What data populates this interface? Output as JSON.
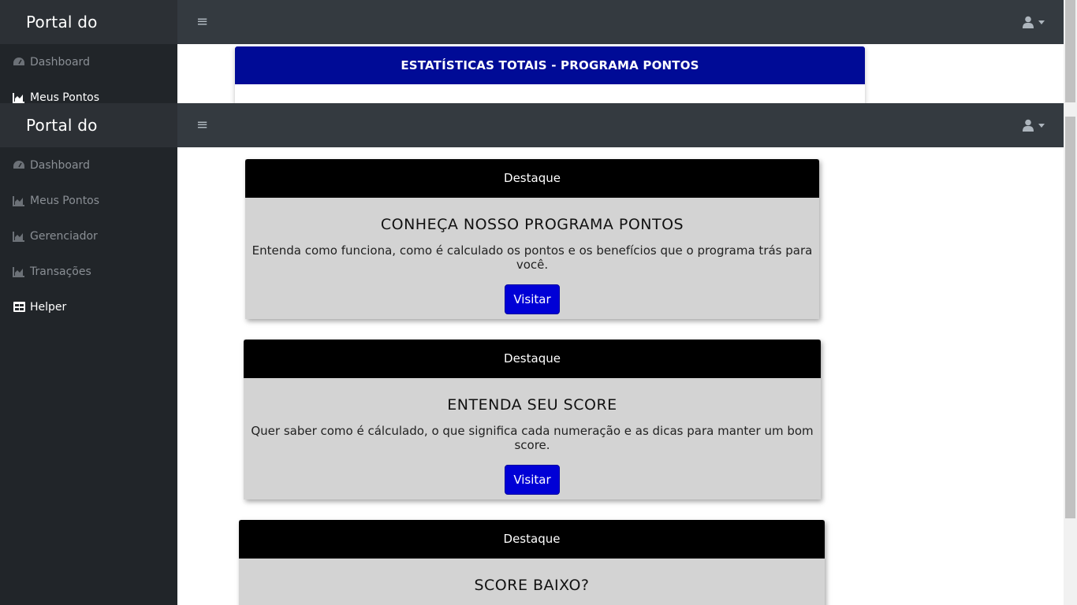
{
  "app": {
    "brand": "Portal do Consumidor",
    "menu_icon": "hamburger-icon",
    "user_icon": "user-icon"
  },
  "background_page": {
    "sidebar": [
      {
        "label": "Dashboard",
        "icon": "tachometer-icon",
        "active": false
      },
      {
        "label": "Meus Pontos",
        "icon": "area-chart-icon",
        "active": true
      }
    ],
    "stats_card_title": "ESTATÍSTICAS TOTAIS - PROGRAMA PONTOS"
  },
  "sidebar": {
    "items": [
      {
        "label": "Dashboard",
        "icon": "tachometer-icon",
        "active": false
      },
      {
        "label": "Meus Pontos",
        "icon": "area-chart-icon",
        "active": false
      },
      {
        "label": "Gerenciador",
        "icon": "area-chart-icon",
        "active": false
      },
      {
        "label": "Transações",
        "icon": "area-chart-icon",
        "active": false
      },
      {
        "label": "Helper",
        "icon": "table-icon",
        "active": true
      }
    ]
  },
  "cards": [
    {
      "header": "Destaque",
      "title": "CONHEÇA NOSSO PROGRAMA PONTOS",
      "text": "Entenda como funciona, como é calculado os pontos e os benefícios que o programa trás para você.",
      "button": "Visitar"
    },
    {
      "header": "Destaque",
      "title": "ENTENDA SEU SCORE",
      "text": "Quer saber como é cálculado, o que significa cada numeração e as dicas para manter um bom score.",
      "button": "Visitar"
    },
    {
      "header": "Destaque",
      "title": "SCORE BAIXO?",
      "text": "",
      "button": ""
    }
  ],
  "colors": {
    "navbar": "#343a40",
    "sidebar": "#212529",
    "stats_header": "#000b96",
    "card_header": "#000000",
    "card_body": "#d3d3d3",
    "button": "#0000d6"
  }
}
